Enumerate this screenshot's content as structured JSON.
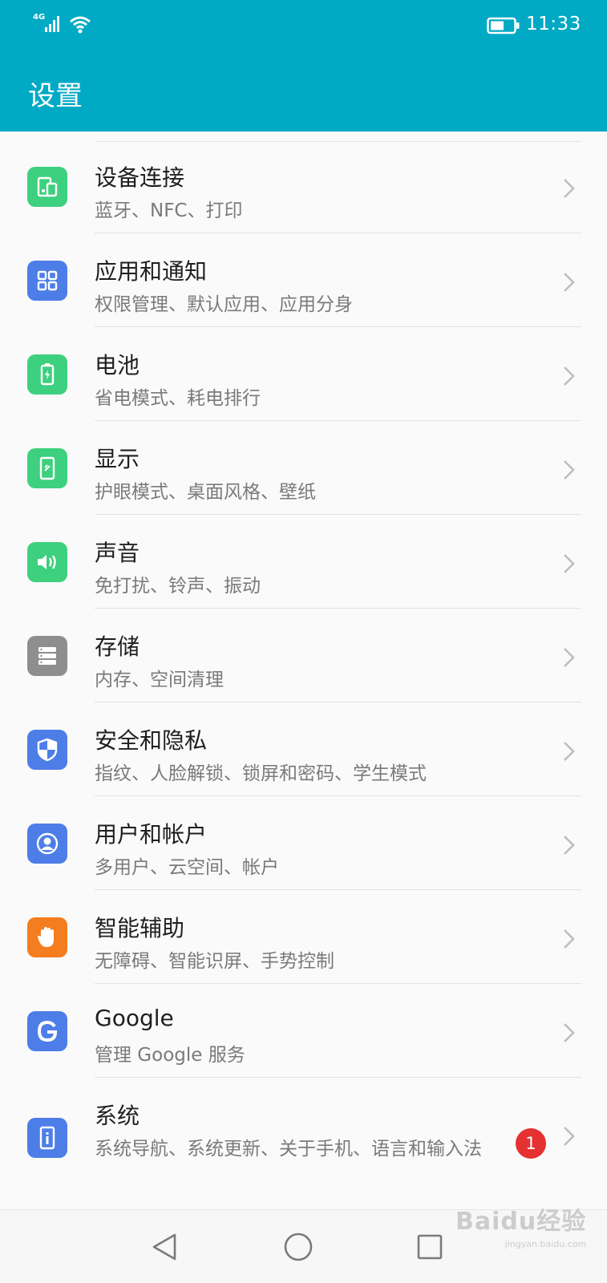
{
  "status_bar": {
    "network_label": "4G",
    "time": "11:33",
    "icons": [
      "signal-icon",
      "wifi-icon",
      "battery-icon"
    ]
  },
  "header": {
    "title": "设置"
  },
  "colors": {
    "primary": "#00a9c4",
    "green": "#3dd07e",
    "blue": "#4d7ee8",
    "gray": "#8e8e8e",
    "orange": "#f47d1f",
    "badge": "#e53131"
  },
  "settings": [
    {
      "title": "设备连接",
      "subtitle": "蓝牙、NFC、打印",
      "icon": "device-connection-icon"
    },
    {
      "title": "应用和通知",
      "subtitle": "权限管理、默认应用、应用分身",
      "icon": "apps-icon"
    },
    {
      "title": "电池",
      "subtitle": "省电模式、耗电排行",
      "icon": "battery-setting-icon"
    },
    {
      "title": "显示",
      "subtitle": "护眼模式、桌面风格、壁纸",
      "icon": "display-icon"
    },
    {
      "title": "声音",
      "subtitle": "免打扰、铃声、振动",
      "icon": "sound-icon"
    },
    {
      "title": "存储",
      "subtitle": "内存、空间清理",
      "icon": "storage-icon"
    },
    {
      "title": "安全和隐私",
      "subtitle": "指纹、人脸解锁、锁屏和密码、学生模式",
      "icon": "shield-icon"
    },
    {
      "title": "用户和帐户",
      "subtitle": "多用户、云空间、帐户",
      "icon": "user-icon"
    },
    {
      "title": "智能辅助",
      "subtitle": "无障碍、智能识屏、手势控制",
      "icon": "hand-icon"
    },
    {
      "title": "Google",
      "subtitle": "管理 Google 服务",
      "icon": "google-icon"
    },
    {
      "title": "系统",
      "subtitle": "系统导航、系统更新、关于手机、语言和输入法",
      "icon": "system-info-icon",
      "badge": "1"
    }
  ],
  "nav_bar": {
    "icons": [
      "back-icon",
      "home-icon",
      "recents-icon"
    ]
  },
  "watermark": {
    "brand": "Baidu经验",
    "url": "jingyan.baidu.com"
  }
}
